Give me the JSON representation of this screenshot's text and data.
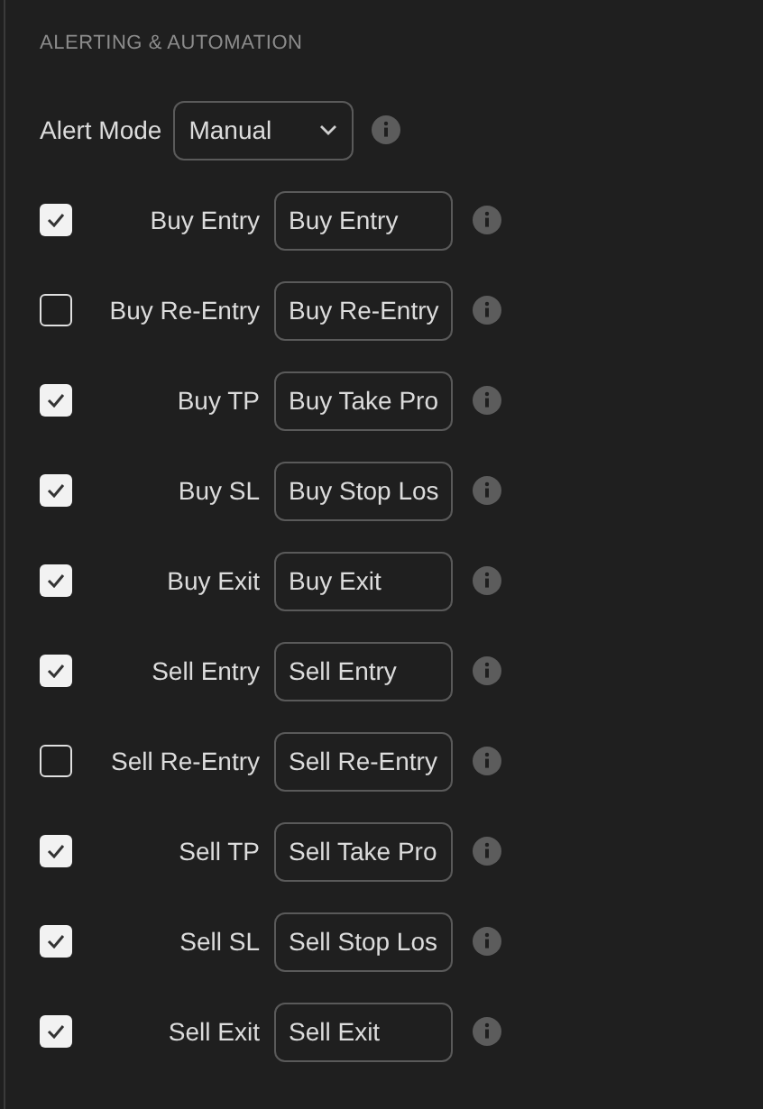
{
  "section": {
    "title": "ALERTING & AUTOMATION"
  },
  "alert_mode": {
    "label": "Alert Mode",
    "value": "Manual"
  },
  "alerts": [
    {
      "label": "Buy Entry",
      "checked": true,
      "value": "Buy Entry"
    },
    {
      "label": "Buy Re-Entry",
      "checked": false,
      "value": "Buy Re-Entry"
    },
    {
      "label": "Buy TP",
      "checked": true,
      "value": "Buy Take Pro"
    },
    {
      "label": "Buy SL",
      "checked": true,
      "value": "Buy Stop Los"
    },
    {
      "label": "Buy Exit",
      "checked": true,
      "value": "Buy Exit"
    },
    {
      "label": "Sell Entry",
      "checked": true,
      "value": "Sell Entry"
    },
    {
      "label": "Sell Re-Entry",
      "checked": false,
      "value": "Sell Re-Entry"
    },
    {
      "label": "Sell TP",
      "checked": true,
      "value": "Sell Take Pro"
    },
    {
      "label": "Sell SL",
      "checked": true,
      "value": "Sell Stop Los"
    },
    {
      "label": "Sell Exit",
      "checked": true,
      "value": "Sell Exit"
    }
  ]
}
